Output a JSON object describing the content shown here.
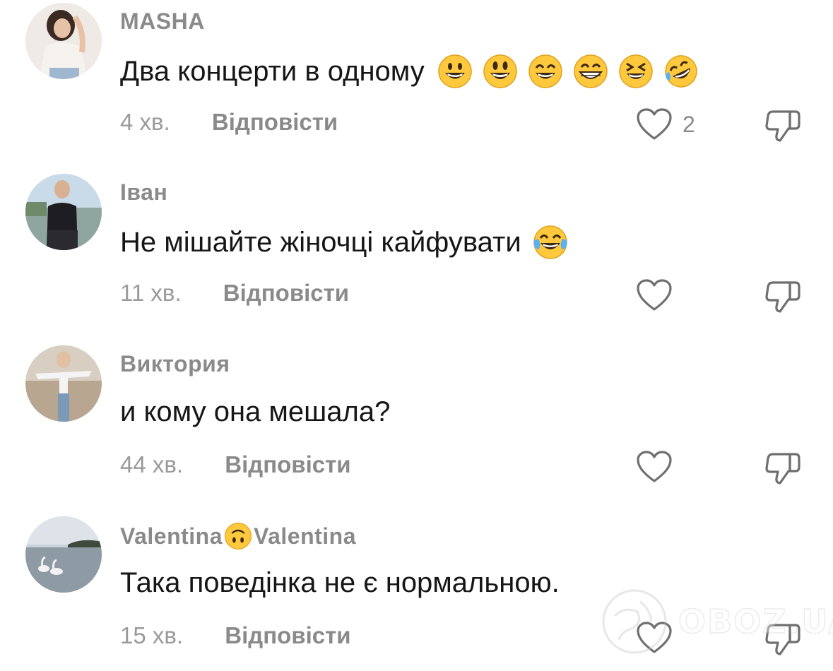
{
  "comments": [
    {
      "username": "MASHA",
      "username_parts": [
        "MASHA",
        ""
      ],
      "text": "Два концерти в одному",
      "emojis": [
        "grinning-face",
        "smiley-face",
        "smile-face",
        "grin-face",
        "laughing-face",
        "rofl-face"
      ],
      "time": "4 хв.",
      "reply_label": "Відповісти",
      "likes": "2"
    },
    {
      "username": "Іван",
      "username_parts": [
        "Іван",
        ""
      ],
      "text": "Не мішайте жіночці кайфувати",
      "emojis": [
        "joy-face"
      ],
      "time": "11 хв.",
      "reply_label": "Відповісти",
      "likes": ""
    },
    {
      "username": "Виктория",
      "username_parts": [
        "Виктория",
        ""
      ],
      "text": "и кому она мешала?",
      "emojis": [],
      "time": "44 хв.",
      "reply_label": "Відповісти",
      "likes": ""
    },
    {
      "username": "Valentina🙃Valentina",
      "username_parts": [
        "Valentina",
        "Valentina"
      ],
      "text": "Така поведінка не є нормальною.",
      "emojis": [],
      "time": "15 хв.",
      "reply_label": "Відповісти",
      "likes": ""
    }
  ],
  "watermark": "OBOZ.UA",
  "colors": {
    "username": "#8a8a8a",
    "text": "#161616",
    "time": "#9a9a9a",
    "icon": "#6f6f6f",
    "emoji_yellow": "#FFC83D"
  }
}
